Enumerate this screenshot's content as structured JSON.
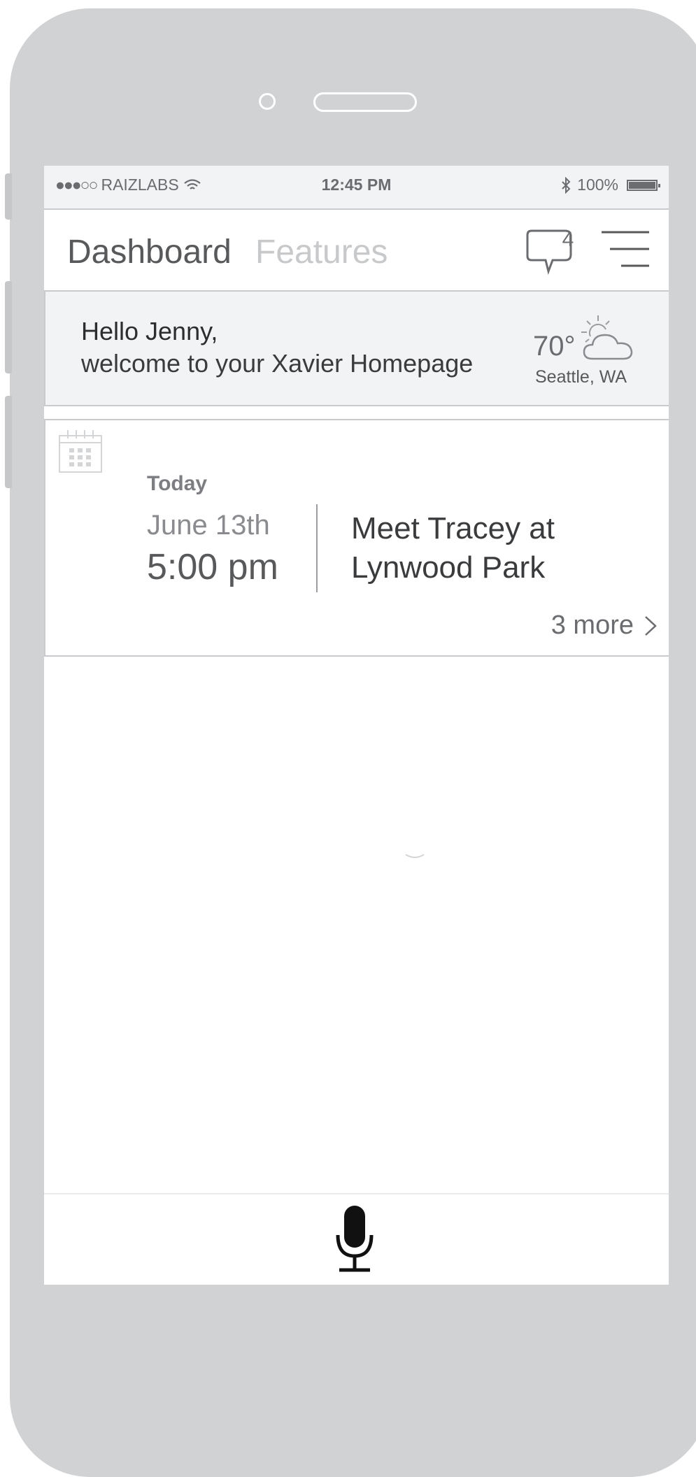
{
  "status_bar": {
    "signal_dots": "●●●○○",
    "carrier": "RAIZLABS",
    "wifi_icon": "wifi-icon",
    "time": "12:45 PM",
    "bluetooth_icon": "bluetooth-icon",
    "battery_text": "100%",
    "battery_level": 1.0
  },
  "nav": {
    "tab_dashboard": "Dashboard",
    "tab_features": "Features",
    "messages_badge": "4",
    "messages_icon": "chat-bubble-icon",
    "menu_icon": "hamburger-menu-icon"
  },
  "greeting": {
    "line1": "Hello Jenny,",
    "line2": "welcome to your Xavier Homepage",
    "temperature": "70°",
    "weather_icon": "partly-cloudy-icon",
    "location": "Seattle, WA"
  },
  "event_card": {
    "calendar_icon": "calendar-icon",
    "day_label": "Today",
    "date": "June 13th",
    "time": "5:00 pm",
    "title_line1": "Meet Tracey at",
    "title_line2": "Lynwood Park",
    "more_label": "3 more",
    "more_icon": "chevron-right-icon"
  },
  "voice": {
    "mic_icon": "microphone-icon"
  },
  "colors": {
    "device_frame": "#d1d2d4",
    "status_bg": "#f2f3f5",
    "primary_text": "#58595b",
    "inactive_tab": "#c8c9cb",
    "border": "#c9cacd"
  }
}
